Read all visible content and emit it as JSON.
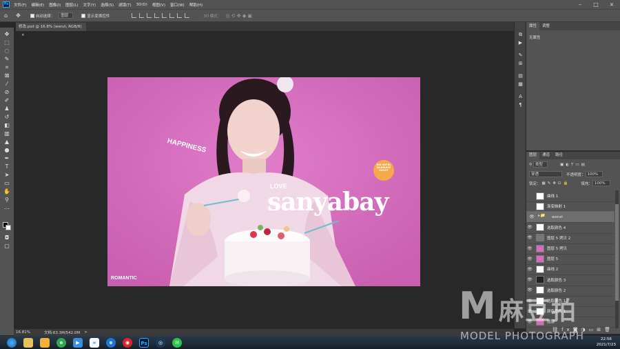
{
  "menubar": {
    "logo": "Ps",
    "items": [
      "文件(F)",
      "编辑(E)",
      "图像(I)",
      "图层(L)",
      "文字(Y)",
      "选择(S)",
      "滤镜(T)",
      "3D(D)",
      "视图(V)",
      "窗口(W)",
      "帮助(H)"
    ]
  },
  "options": {
    "auto_select_label": "自动选择：",
    "auto_select_value": "图层",
    "show_transform_label": "显示变换控件",
    "mode_3d_label": "3D 模式："
  },
  "document": {
    "tab_title": "修改.psd @ 16.8% (wenzi, RGB/8)",
    "close_glyph": "×"
  },
  "canvas_text": {
    "happiness": "HAPPINESS",
    "love": "LOVE",
    "brand": "sanyabay",
    "romantic": "ROMANTIC",
    "badge": "JUS HOTEL MARRIAGE SHOOT"
  },
  "status": {
    "zoom": "16.81%",
    "doc_size": "文档:63.3M/542.0M",
    "arrow": ">"
  },
  "properties": {
    "tabs": [
      "属性",
      "调整"
    ],
    "content": "无属性"
  },
  "layers_panel": {
    "tabs": [
      "图层",
      "通道",
      "路径"
    ],
    "filter_label": "类型",
    "blend_mode": "穿透",
    "opacity_label": "不透明度：",
    "opacity_value": "100%",
    "lock_label": "锁定：",
    "fill_label": "填充：",
    "fill_value": "100%",
    "layers": [
      {
        "name": "曲线 1",
        "visible": false,
        "type": "adjust"
      },
      {
        "name": "渐变映射 1",
        "visible": false,
        "type": "adjust"
      },
      {
        "name": "wenzi",
        "visible": true,
        "type": "group"
      },
      {
        "name": "选取颜色 4",
        "visible": true,
        "type": "adjust"
      },
      {
        "name": "图层 5 拷贝 2",
        "visible": true,
        "type": "pixel"
      },
      {
        "name": "图层 5 拷贝",
        "visible": true,
        "type": "photo"
      },
      {
        "name": "图层 5",
        "visible": true,
        "type": "photo"
      },
      {
        "name": "曲线 2",
        "visible": true,
        "type": "adjust"
      },
      {
        "name": "选取颜色 3",
        "visible": true,
        "type": "mask"
      },
      {
        "name": "选取颜色 2",
        "visible": true,
        "type": "adjust"
      },
      {
        "name": "选取颜色 1",
        "visible": true,
        "type": "adjust"
      },
      {
        "name": "颜色查找 1",
        "visible": true,
        "type": "adjust"
      },
      {
        "name": "图层",
        "visible": true,
        "type": "photo"
      }
    ]
  },
  "taskbar": {
    "apps": [
      "start",
      "explorer",
      "library",
      "ie-green",
      "media",
      "apps",
      "ie",
      "netease",
      "Ps",
      "c4d",
      "wechat"
    ],
    "time": "22:56",
    "date": "2021/7/23"
  },
  "watermark": {
    "logo_letter": "M",
    "chinese": "麻豆拍",
    "english": "MODEL PHOTOGRAPH"
  },
  "colors": {
    "canvas_pink": "#d66cbd",
    "panel_bg": "#535353",
    "workspace": "#282828",
    "ps_blue": "#31a8ff"
  }
}
